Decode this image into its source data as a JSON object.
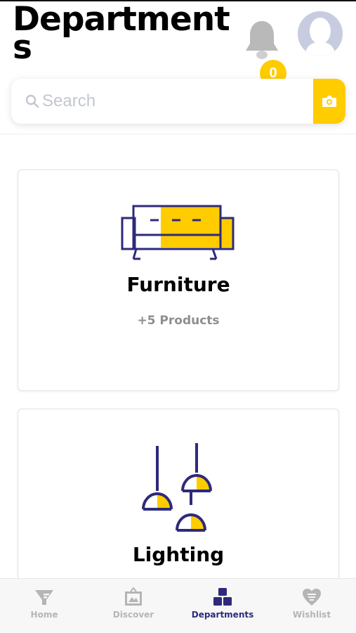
{
  "header": {
    "title": "Departments",
    "notification_count": "0",
    "icons": {
      "bell": "bell-icon",
      "avatar": "user-avatar"
    }
  },
  "search": {
    "placeholder": "Search",
    "value": "",
    "icons": {
      "search": "search-icon",
      "camera": "camera-icon"
    }
  },
  "departments": [
    {
      "name": "Furniture",
      "count": "+5 Products",
      "icon": "sofa-icon"
    },
    {
      "name": "Lighting",
      "count": "",
      "icon": "pendant-lamps-icon"
    }
  ],
  "bottom_nav": {
    "active": "Departments",
    "items": [
      {
        "label": "Home",
        "icon": "home-icon"
      },
      {
        "label": "Discover",
        "icon": "frame-icon"
      },
      {
        "label": "Departments",
        "icon": "blocks-icon"
      },
      {
        "label": "Wishlist",
        "icon": "heart-icon"
      }
    ]
  },
  "colors": {
    "accent_yellow": "#ffcc00",
    "brand_navy": "#2e2a7a",
    "muted_gray": "#b5b5b5",
    "avatar_bg": "#c8cce0"
  }
}
